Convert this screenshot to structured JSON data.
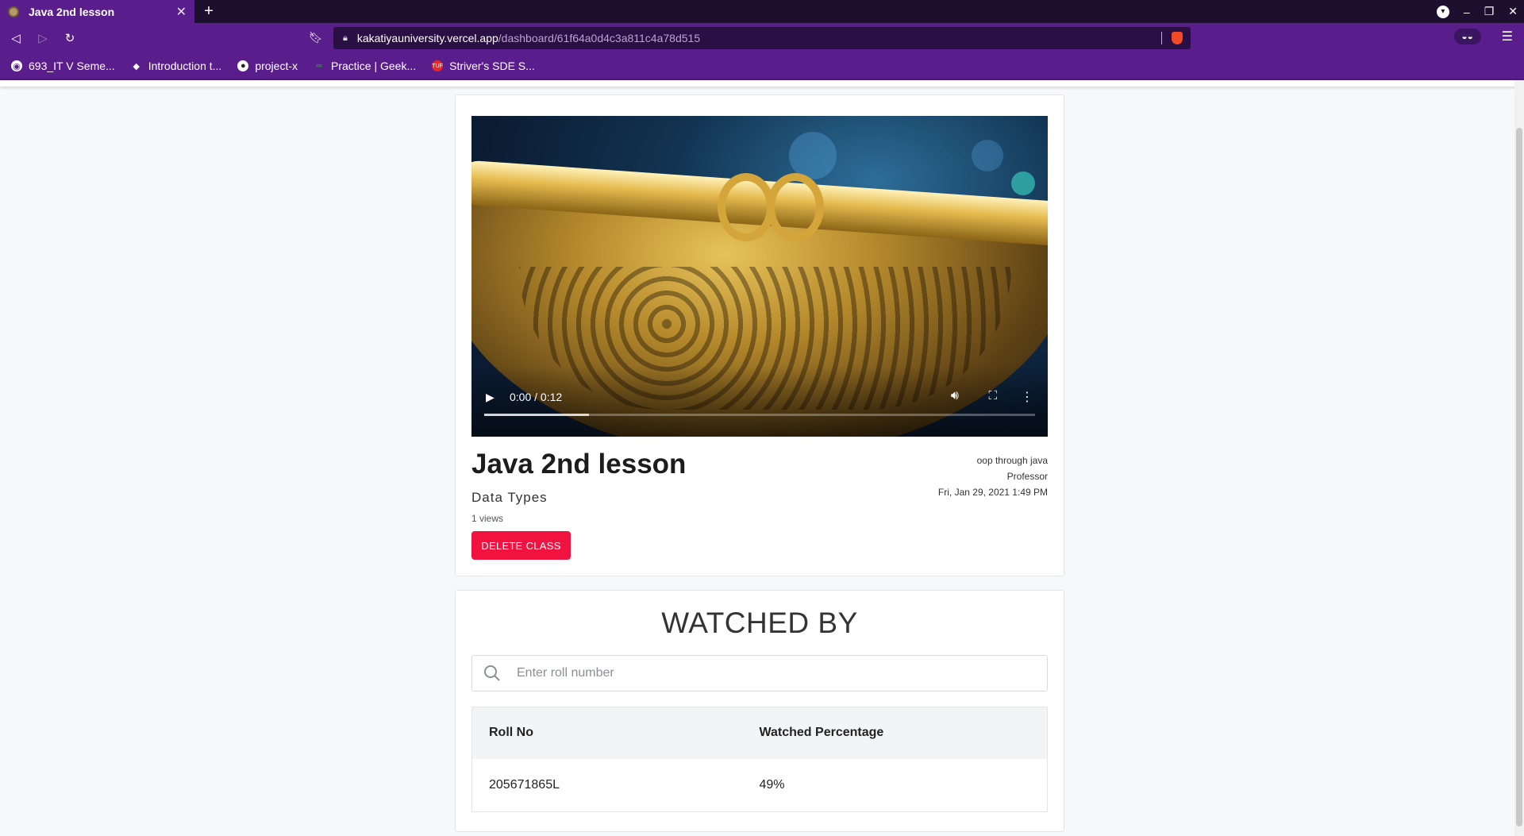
{
  "browser": {
    "tab_title": "Java 2nd lesson",
    "tab_close": "✕",
    "new_tab": "+",
    "url_host": "kakatiyauniversity.vercel.app",
    "url_path": "/dashboard/61f64a0d4c3a811c4a78d515",
    "bookmarks": [
      {
        "label": "693_IT V Seme...",
        "icon": "globe-icon"
      },
      {
        "label": "Introduction t...",
        "icon": "ethereum-icon"
      },
      {
        "label": "project-x",
        "icon": "github-icon"
      },
      {
        "label": "Practice | Geek...",
        "icon": "gfg-icon"
      },
      {
        "label": "Striver's SDE S...",
        "icon": "tuf-icon"
      }
    ]
  },
  "video": {
    "time": "0:00 / 0:12",
    "buffered_fraction": 0.19
  },
  "lesson": {
    "title": "Java 2nd lesson",
    "subtitle": "Data Types",
    "views": "1 views",
    "delete_label": "DELETE CLASS",
    "course": "oop through java",
    "role": "Professor",
    "date": "Fri, Jan 29, 2021 1:49 PM"
  },
  "watched": {
    "title": "WATCHED BY",
    "search_placeholder": "Enter roll number",
    "columns": [
      "Roll No",
      "Watched Percentage"
    ],
    "rows": [
      [
        "205671865L",
        "49%"
      ]
    ]
  },
  "colors": {
    "browser_purple": "#5a1e8c",
    "delete_button": "#f0133f"
  }
}
